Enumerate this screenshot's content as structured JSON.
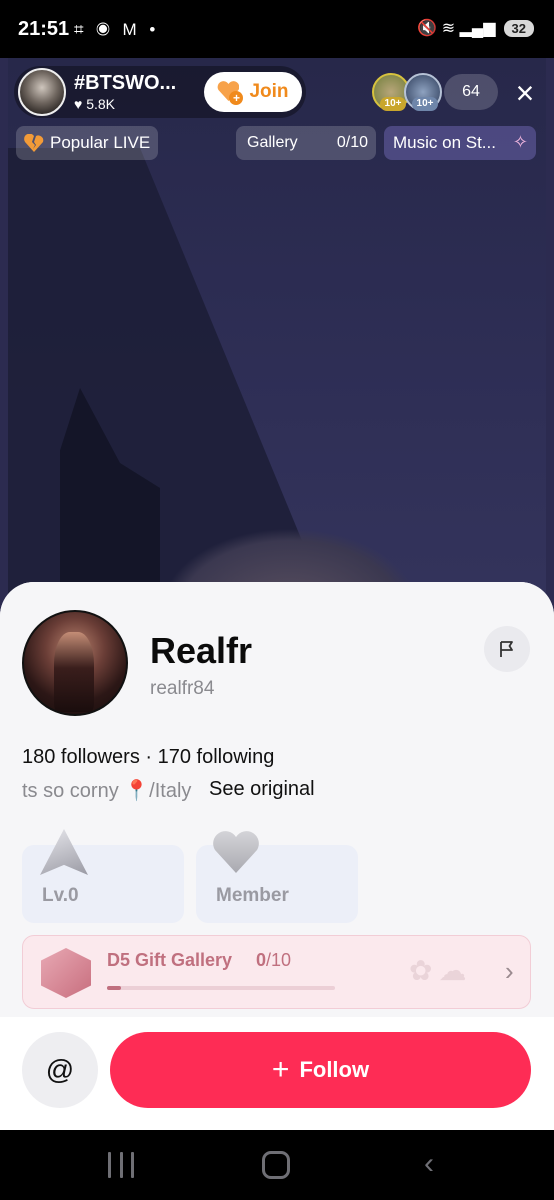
{
  "status_bar": {
    "time": "21:51",
    "left_icons": "⌗ ◉ M •",
    "right_icons": "🔇 ≋ ▂▄▆",
    "battery": "32"
  },
  "live": {
    "host_name": "#BTSWO...",
    "likes": "5.8K",
    "join_label": "Join",
    "viewer_badges": [
      "10+",
      "10+"
    ],
    "viewer_count": "64",
    "close_icon": "×",
    "chips": {
      "popular": "Popular LIVE",
      "gallery": "Gallery",
      "gallery_count": "0",
      "gallery_total": "/10",
      "music": "Music on St..."
    }
  },
  "profile": {
    "display_name": "Realfr",
    "username": "realfr84",
    "stats": "180 followers · 170 following",
    "bio": "ts so corny 📍/Italy",
    "see_original": "See original",
    "badges": {
      "level": "Lv.0",
      "member": "Member"
    },
    "gift_gallery": {
      "title": "D5 Gift Gallery",
      "count": "0",
      "total": "/10",
      "progress": 0.06
    },
    "at_label": "@",
    "follow_label": "Follow",
    "follow_plus": "+"
  },
  "colors": {
    "follow": "#fe2c55",
    "join_text": "#f08a1c",
    "gift_text": "#c0707f"
  }
}
